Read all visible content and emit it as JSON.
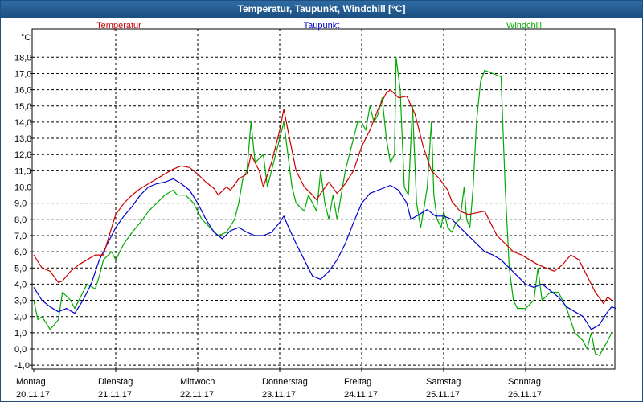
{
  "window": {
    "title": "Temperatur, Taupunkt, Windchill [°C]"
  },
  "chart_data": {
    "type": "line",
    "title": "Temperatur, Taupunkt, Windchill [°C]",
    "ylabel": "°C",
    "ylim": [
      -1.5,
      19.0
    ],
    "yticks": [
      "-1,0",
      "0,0",
      "1,0",
      "2,0",
      "3,0",
      "4,0",
      "5,0",
      "6,0",
      "7,0",
      "8,0",
      "9,0",
      "10,0",
      "11,0",
      "12,0",
      "13,0",
      "14,0",
      "15,0",
      "16,0",
      "17,0",
      "18,0"
    ],
    "xlim": [
      0,
      7.1
    ],
    "x_unit": "days since Monday 20.11.17 00:00",
    "xticks": [
      {
        "day": "Montag",
        "date": "20.11.17"
      },
      {
        "day": "Dienstag",
        "date": "21.11.17"
      },
      {
        "day": "Mittwoch",
        "date": "22.11.17"
      },
      {
        "day": "Donnerstag",
        "date": "23.11.17"
      },
      {
        "day": "Freitag",
        "date": "24.11.17"
      },
      {
        "day": "Samstag",
        "date": "25.11.17"
      },
      {
        "day": "Sonntag",
        "date": "26.11.17"
      }
    ],
    "grid": true,
    "series": [
      {
        "name": "Temperatur",
        "color": "#cc0000",
        "points": [
          [
            0,
            5.8
          ],
          [
            0.1,
            5.0
          ],
          [
            0.2,
            4.8
          ],
          [
            0.3,
            4.1
          ],
          [
            0.35,
            4.2
          ],
          [
            0.45,
            4.8
          ],
          [
            0.55,
            5.2
          ],
          [
            0.65,
            5.5
          ],
          [
            0.75,
            5.8
          ],
          [
            0.85,
            5.8
          ],
          [
            0.95,
            7.5
          ],
          [
            1.0,
            8.3
          ],
          [
            1.1,
            9.0
          ],
          [
            1.2,
            9.5
          ],
          [
            1.3,
            9.9
          ],
          [
            1.4,
            10.2
          ],
          [
            1.5,
            10.5
          ],
          [
            1.6,
            10.8
          ],
          [
            1.7,
            11.1
          ],
          [
            1.8,
            11.3
          ],
          [
            1.9,
            11.2
          ],
          [
            2.0,
            10.8
          ],
          [
            2.1,
            10.3
          ],
          [
            2.2,
            9.9
          ],
          [
            2.25,
            9.5
          ],
          [
            2.35,
            10.0
          ],
          [
            2.4,
            9.8
          ],
          [
            2.5,
            10.5
          ],
          [
            2.6,
            10.8
          ],
          [
            2.65,
            12.0
          ],
          [
            2.75,
            11.0
          ],
          [
            2.8,
            10.0
          ],
          [
            2.9,
            11.5
          ],
          [
            3.0,
            13.5
          ],
          [
            3.05,
            14.8
          ],
          [
            3.1,
            13.5
          ],
          [
            3.2,
            11.0
          ],
          [
            3.3,
            10.0
          ],
          [
            3.4,
            9.5
          ],
          [
            3.45,
            9.2
          ],
          [
            3.5,
            9.6
          ],
          [
            3.6,
            10.3
          ],
          [
            3.7,
            9.6
          ],
          [
            3.8,
            10.2
          ],
          [
            3.9,
            11.0
          ],
          [
            4.0,
            12.5
          ],
          [
            4.1,
            13.5
          ],
          [
            4.2,
            14.8
          ],
          [
            4.3,
            15.8
          ],
          [
            4.35,
            16.0
          ],
          [
            4.45,
            15.5
          ],
          [
            4.55,
            15.6
          ],
          [
            4.65,
            14.5
          ],
          [
            4.75,
            12.5
          ],
          [
            4.85,
            11.0
          ],
          [
            4.95,
            10.5
          ],
          [
            5.05,
            9.8
          ],
          [
            5.1,
            9.1
          ],
          [
            5.2,
            8.5
          ],
          [
            5.3,
            8.3
          ],
          [
            5.4,
            8.4
          ],
          [
            5.5,
            8.5
          ],
          [
            5.55,
            8.0
          ],
          [
            5.65,
            7.0
          ],
          [
            5.75,
            6.5
          ],
          [
            5.85,
            6.0
          ],
          [
            5.95,
            5.8
          ],
          [
            6.05,
            5.5
          ],
          [
            6.15,
            5.2
          ],
          [
            6.25,
            5.0
          ],
          [
            6.35,
            4.8
          ],
          [
            6.45,
            5.2
          ],
          [
            6.55,
            5.8
          ],
          [
            6.65,
            5.5
          ],
          [
            6.75,
            4.5
          ],
          [
            6.85,
            3.5
          ],
          [
            6.95,
            2.8
          ],
          [
            7.0,
            3.2
          ],
          [
            7.05,
            3.0
          ]
        ]
      },
      {
        "name": "Taupunkt",
        "color": "#0000cc",
        "points": [
          [
            0,
            3.8
          ],
          [
            0.1,
            3.0
          ],
          [
            0.2,
            2.6
          ],
          [
            0.3,
            2.3
          ],
          [
            0.4,
            2.5
          ],
          [
            0.5,
            2.2
          ],
          [
            0.6,
            3.0
          ],
          [
            0.7,
            4.0
          ],
          [
            0.8,
            5.5
          ],
          [
            0.9,
            6.5
          ],
          [
            1.0,
            7.5
          ],
          [
            1.1,
            8.2
          ],
          [
            1.2,
            8.8
          ],
          [
            1.3,
            9.5
          ],
          [
            1.4,
            10.0
          ],
          [
            1.5,
            10.2
          ],
          [
            1.6,
            10.3
          ],
          [
            1.7,
            10.5
          ],
          [
            1.8,
            10.2
          ],
          [
            1.9,
            9.8
          ],
          [
            2.0,
            9.0
          ],
          [
            2.1,
            8.0
          ],
          [
            2.2,
            7.2
          ],
          [
            2.3,
            6.8
          ],
          [
            2.4,
            7.3
          ],
          [
            2.5,
            7.5
          ],
          [
            2.6,
            7.2
          ],
          [
            2.7,
            7.0
          ],
          [
            2.8,
            7.0
          ],
          [
            2.9,
            7.2
          ],
          [
            3.0,
            7.8
          ],
          [
            3.05,
            8.2
          ],
          [
            3.1,
            7.6
          ],
          [
            3.2,
            6.5
          ],
          [
            3.3,
            5.5
          ],
          [
            3.4,
            4.5
          ],
          [
            3.5,
            4.3
          ],
          [
            3.6,
            4.8
          ],
          [
            3.7,
            5.5
          ],
          [
            3.8,
            6.5
          ],
          [
            3.9,
            7.8
          ],
          [
            4.0,
            9.0
          ],
          [
            4.1,
            9.6
          ],
          [
            4.2,
            9.8
          ],
          [
            4.3,
            10.0
          ],
          [
            4.35,
            10.1
          ],
          [
            4.45,
            9.8
          ],
          [
            4.55,
            9.0
          ],
          [
            4.6,
            8.0
          ],
          [
            4.7,
            8.3
          ],
          [
            4.8,
            8.6
          ],
          [
            4.9,
            8.2
          ],
          [
            5.0,
            8.2
          ],
          [
            5.1,
            8.0
          ],
          [
            5.2,
            7.5
          ],
          [
            5.3,
            7.0
          ],
          [
            5.4,
            6.5
          ],
          [
            5.5,
            6.0
          ],
          [
            5.6,
            5.8
          ],
          [
            5.7,
            5.5
          ],
          [
            5.8,
            5.0
          ],
          [
            5.9,
            4.5
          ],
          [
            6.0,
            4.0
          ],
          [
            6.1,
            3.8
          ],
          [
            6.2,
            4.0
          ],
          [
            6.3,
            3.6
          ],
          [
            6.4,
            3.2
          ],
          [
            6.5,
            2.6
          ],
          [
            6.6,
            2.3
          ],
          [
            6.7,
            2.0
          ],
          [
            6.8,
            1.2
          ],
          [
            6.9,
            1.5
          ],
          [
            7.0,
            2.3
          ],
          [
            7.05,
            2.6
          ],
          [
            7.1,
            2.5
          ]
        ]
      },
      {
        "name": "Windchill",
        "color": "#00aa00",
        "points": [
          [
            0,
            3.0
          ],
          [
            0.05,
            1.8
          ],
          [
            0.1,
            2.0
          ],
          [
            0.2,
            1.2
          ],
          [
            0.3,
            1.8
          ],
          [
            0.35,
            3.5
          ],
          [
            0.45,
            3.0
          ],
          [
            0.5,
            2.5
          ],
          [
            0.6,
            3.5
          ],
          [
            0.65,
            4.0
          ],
          [
            0.75,
            3.7
          ],
          [
            0.8,
            4.5
          ],
          [
            0.85,
            5.5
          ],
          [
            0.95,
            6.0
          ],
          [
            1.0,
            5.5
          ],
          [
            1.1,
            6.5
          ],
          [
            1.2,
            7.2
          ],
          [
            1.3,
            7.8
          ],
          [
            1.4,
            8.5
          ],
          [
            1.5,
            9.0
          ],
          [
            1.6,
            9.5
          ],
          [
            1.7,
            9.8
          ],
          [
            1.75,
            9.5
          ],
          [
            1.85,
            9.5
          ],
          [
            1.95,
            9.0
          ],
          [
            2.05,
            8.0
          ],
          [
            2.15,
            7.5
          ],
          [
            2.25,
            7.0
          ],
          [
            2.35,
            7.2
          ],
          [
            2.45,
            8.0
          ],
          [
            2.5,
            9.0
          ],
          [
            2.55,
            10.5
          ],
          [
            2.6,
            11.0
          ],
          [
            2.65,
            14.0
          ],
          [
            2.7,
            11.5
          ],
          [
            2.8,
            12.0
          ],
          [
            2.85,
            10.0
          ],
          [
            2.9,
            11.0
          ],
          [
            3.0,
            13.0
          ],
          [
            3.05,
            14.0
          ],
          [
            3.1,
            12.0
          ],
          [
            3.15,
            10.0
          ],
          [
            3.2,
            9.0
          ],
          [
            3.3,
            8.5
          ],
          [
            3.35,
            9.5
          ],
          [
            3.4,
            9.0
          ],
          [
            3.45,
            8.5
          ],
          [
            3.5,
            11.0
          ],
          [
            3.55,
            9.0
          ],
          [
            3.6,
            8.0
          ],
          [
            3.65,
            9.5
          ],
          [
            3.7,
            8.0
          ],
          [
            3.8,
            11.0
          ],
          [
            3.85,
            12.0
          ],
          [
            3.9,
            13.0
          ],
          [
            3.95,
            14.0
          ],
          [
            4.0,
            14.0
          ],
          [
            4.05,
            13.5
          ],
          [
            4.1,
            15.0
          ],
          [
            4.15,
            14.0
          ],
          [
            4.2,
            14.5
          ],
          [
            4.25,
            15.5
          ],
          [
            4.3,
            13.0
          ],
          [
            4.35,
            11.5
          ],
          [
            4.4,
            12.0
          ],
          [
            4.42,
            18.0
          ],
          [
            4.47,
            16.0
          ],
          [
            4.52,
            10.0
          ],
          [
            4.57,
            9.5
          ],
          [
            4.62,
            15.0
          ],
          [
            4.67,
            9.0
          ],
          [
            4.72,
            7.5
          ],
          [
            4.77,
            9.0
          ],
          [
            4.8,
            10.0
          ],
          [
            4.85,
            14.0
          ],
          [
            4.88,
            9.5
          ],
          [
            4.92,
            8.0
          ],
          [
            4.97,
            7.5
          ],
          [
            5.0,
            8.5
          ],
          [
            5.05,
            7.5
          ],
          [
            5.1,
            7.2
          ],
          [
            5.15,
            7.8
          ],
          [
            5.2,
            8.0
          ],
          [
            5.25,
            10.0
          ],
          [
            5.28,
            8.0
          ],
          [
            5.32,
            7.5
          ],
          [
            5.36,
            10.0
          ],
          [
            5.4,
            14.0
          ],
          [
            5.45,
            16.5
          ],
          [
            5.5,
            17.2
          ],
          [
            5.6,
            17.0
          ],
          [
            5.7,
            16.8
          ],
          [
            5.75,
            10.0
          ],
          [
            5.8,
            5.0
          ],
          [
            5.85,
            3.0
          ],
          [
            5.9,
            2.5
          ],
          [
            6.0,
            2.5
          ],
          [
            6.1,
            3.0
          ],
          [
            6.15,
            5.0
          ],
          [
            6.2,
            3.0
          ],
          [
            6.3,
            3.5
          ],
          [
            6.4,
            3.5
          ],
          [
            6.5,
            2.5
          ],
          [
            6.6,
            1.0
          ],
          [
            6.7,
            0.5
          ],
          [
            6.75,
            0.0
          ],
          [
            6.8,
            1.0
          ],
          [
            6.85,
            -0.3
          ],
          [
            6.9,
            -0.4
          ],
          [
            7.0,
            0.5
          ],
          [
            7.05,
            1.0
          ]
        ]
      }
    ]
  }
}
